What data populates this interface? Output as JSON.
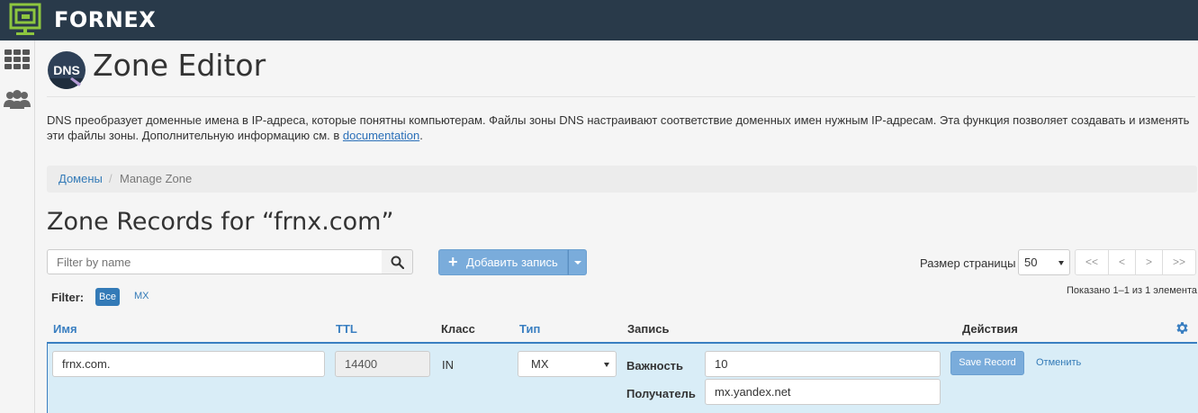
{
  "brand": {
    "name": "FORNEX",
    "accent": "#8dc63f"
  },
  "header": {
    "title": "Zone Editor",
    "dns_logo_text": "DNS",
    "description": "DNS преобразует доменные имена в IP-адреса, которые понятны компьютерам. Файлы зоны DNS настраивают соответствие доменных имен нужным IP-адресам. Эта функция позволяет создавать и изменять эти файлы зоны. Дополнительную информацию см. в ",
    "description_link": "documentation",
    "description_end": "."
  },
  "breadcrumb": {
    "link": "Домены",
    "separator": "/",
    "current": "Manage Zone"
  },
  "zone_title": "Zone Records for “frnx.com”",
  "toolbar": {
    "filter_placeholder": "Filter by name",
    "add_label": "Добавить запись",
    "add_plus": "+",
    "page_size_label": "Размер страницы",
    "page_size_value": "50",
    "pager": [
      "<<",
      "<",
      ">",
      ">>"
    ]
  },
  "filters": {
    "label": "Filter:",
    "all": "Все",
    "mx": "MX"
  },
  "shown_text": "Показано 1–1 из 1 элемента",
  "columns": {
    "name": "Имя",
    "ttl": "TTL",
    "class": "Класс",
    "type": "Тип",
    "record": "Запись",
    "actions": "Действия"
  },
  "edit_row": {
    "name": "frnx.com.",
    "ttl": "14400",
    "class": "IN",
    "type": "MX",
    "priority_label": "Важность",
    "priority": "10",
    "target_label": "Получатель",
    "target": "mx.yandex.net",
    "save_label": "Save Record",
    "cancel_label": "Отменить"
  },
  "icons": {
    "sidebar": [
      "grid-icon",
      "users-icon"
    ],
    "search": "search-icon",
    "settings": "gear-icon"
  }
}
